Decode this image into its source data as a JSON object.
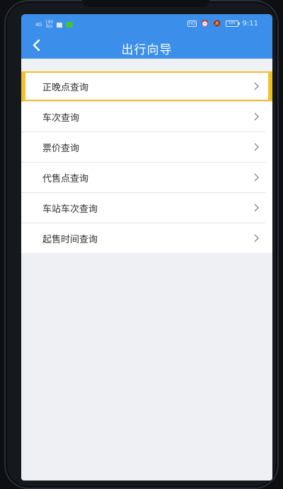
{
  "status_bar": {
    "signal": "4G",
    "net_speed": "190\nB/s",
    "app_badge": "微",
    "hd": "HD",
    "battery": "100",
    "time": "9:11"
  },
  "header": {
    "title": "出行向导",
    "back_icon": "back-arrow-icon"
  },
  "menu": {
    "items": [
      {
        "label": "正晚点查询",
        "highlighted": true
      },
      {
        "label": "车次查询"
      },
      {
        "label": "票价查询"
      },
      {
        "label": "代售点查询"
      },
      {
        "label": "车站车次查询"
      },
      {
        "label": "起售时间查询"
      }
    ]
  },
  "colors": {
    "header": "#3b8fea",
    "highlight": "#f3c12a",
    "background": "#eef0f4"
  }
}
